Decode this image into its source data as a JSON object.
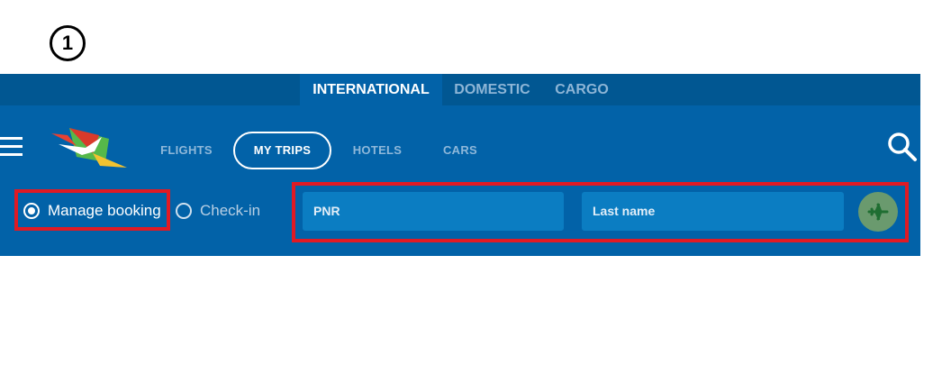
{
  "annotation": {
    "step": "1"
  },
  "regions": [
    "INTERNATIONAL",
    "DOMESTIC",
    "CARGO"
  ],
  "nav": {
    "items": [
      "FLIGHTS",
      "MY TRIPS",
      "HOTELS",
      "CARS"
    ],
    "active": "MY TRIPS"
  },
  "booking_type": {
    "options": [
      "Manage booking",
      "Check-in"
    ],
    "selected": "Manage booking"
  },
  "form": {
    "pnr_placeholder": "PNR",
    "lastname_placeholder": "Last name"
  },
  "icons": {
    "menu": "hamburger-menu-icon",
    "search": "search-icon",
    "submit": "airplane-icon"
  },
  "colors": {
    "primary": "#0262a8",
    "region_bar": "#015792",
    "highlight": "#e01a24",
    "submit": "#6a9a6e"
  }
}
